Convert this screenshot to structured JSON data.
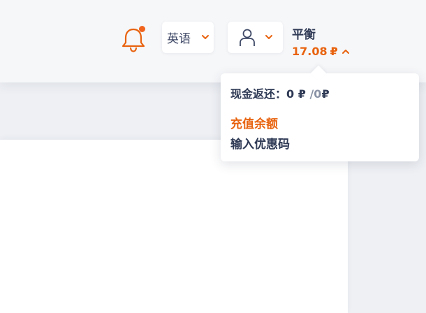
{
  "header": {
    "notifications": {
      "icon": "bell-icon",
      "has_unread": true
    },
    "language": {
      "label": "英语",
      "icon": "chevron-down-icon"
    },
    "user_menu": {
      "icon": "user-icon",
      "chevron": "chevron-down-icon"
    },
    "balance": {
      "label": "平衡",
      "amount": "17.08",
      "currency": "₽",
      "icon": "chevron-up-icon"
    }
  },
  "balance_dropdown": {
    "cashback_label": "现金返还：",
    "cashback_amount": "0",
    "cashback_currency": "₽",
    "cashback_separator": "/",
    "cashback_limit": "0",
    "cashback_limit_currency": "₽",
    "topup_label": "充值余额",
    "promo_label": "输入优惠码"
  },
  "colors": {
    "accent": "#e8630f",
    "text": "#2f3a55",
    "muted": "#8a93a6",
    "background": "#f2f4f7"
  }
}
